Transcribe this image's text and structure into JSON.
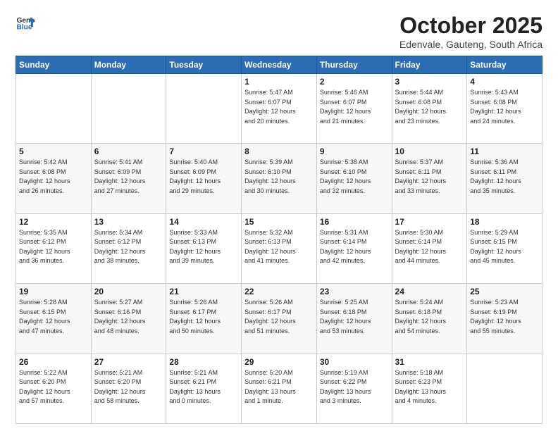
{
  "header": {
    "logo_general": "General",
    "logo_blue": "Blue",
    "title": "October 2025",
    "subtitle": "Edenvale, Gauteng, South Africa"
  },
  "weekdays": [
    "Sunday",
    "Monday",
    "Tuesday",
    "Wednesday",
    "Thursday",
    "Friday",
    "Saturday"
  ],
  "weeks": [
    [
      {
        "day": "",
        "info": ""
      },
      {
        "day": "",
        "info": ""
      },
      {
        "day": "",
        "info": ""
      },
      {
        "day": "1",
        "info": "Sunrise: 5:47 AM\nSunset: 6:07 PM\nDaylight: 12 hours\nand 20 minutes."
      },
      {
        "day": "2",
        "info": "Sunrise: 5:46 AM\nSunset: 6:07 PM\nDaylight: 12 hours\nand 21 minutes."
      },
      {
        "day": "3",
        "info": "Sunrise: 5:44 AM\nSunset: 6:08 PM\nDaylight: 12 hours\nand 23 minutes."
      },
      {
        "day": "4",
        "info": "Sunrise: 5:43 AM\nSunset: 6:08 PM\nDaylight: 12 hours\nand 24 minutes."
      }
    ],
    [
      {
        "day": "5",
        "info": "Sunrise: 5:42 AM\nSunset: 6:08 PM\nDaylight: 12 hours\nand 26 minutes."
      },
      {
        "day": "6",
        "info": "Sunrise: 5:41 AM\nSunset: 6:09 PM\nDaylight: 12 hours\nand 27 minutes."
      },
      {
        "day": "7",
        "info": "Sunrise: 5:40 AM\nSunset: 6:09 PM\nDaylight: 12 hours\nand 29 minutes."
      },
      {
        "day": "8",
        "info": "Sunrise: 5:39 AM\nSunset: 6:10 PM\nDaylight: 12 hours\nand 30 minutes."
      },
      {
        "day": "9",
        "info": "Sunrise: 5:38 AM\nSunset: 6:10 PM\nDaylight: 12 hours\nand 32 minutes."
      },
      {
        "day": "10",
        "info": "Sunrise: 5:37 AM\nSunset: 6:11 PM\nDaylight: 12 hours\nand 33 minutes."
      },
      {
        "day": "11",
        "info": "Sunrise: 5:36 AM\nSunset: 6:11 PM\nDaylight: 12 hours\nand 35 minutes."
      }
    ],
    [
      {
        "day": "12",
        "info": "Sunrise: 5:35 AM\nSunset: 6:12 PM\nDaylight: 12 hours\nand 36 minutes."
      },
      {
        "day": "13",
        "info": "Sunrise: 5:34 AM\nSunset: 6:12 PM\nDaylight: 12 hours\nand 38 minutes."
      },
      {
        "day": "14",
        "info": "Sunrise: 5:33 AM\nSunset: 6:13 PM\nDaylight: 12 hours\nand 39 minutes."
      },
      {
        "day": "15",
        "info": "Sunrise: 5:32 AM\nSunset: 6:13 PM\nDaylight: 12 hours\nand 41 minutes."
      },
      {
        "day": "16",
        "info": "Sunrise: 5:31 AM\nSunset: 6:14 PM\nDaylight: 12 hours\nand 42 minutes."
      },
      {
        "day": "17",
        "info": "Sunrise: 5:30 AM\nSunset: 6:14 PM\nDaylight: 12 hours\nand 44 minutes."
      },
      {
        "day": "18",
        "info": "Sunrise: 5:29 AM\nSunset: 6:15 PM\nDaylight: 12 hours\nand 45 minutes."
      }
    ],
    [
      {
        "day": "19",
        "info": "Sunrise: 5:28 AM\nSunset: 6:15 PM\nDaylight: 12 hours\nand 47 minutes."
      },
      {
        "day": "20",
        "info": "Sunrise: 5:27 AM\nSunset: 6:16 PM\nDaylight: 12 hours\nand 48 minutes."
      },
      {
        "day": "21",
        "info": "Sunrise: 5:26 AM\nSunset: 6:17 PM\nDaylight: 12 hours\nand 50 minutes."
      },
      {
        "day": "22",
        "info": "Sunrise: 5:26 AM\nSunset: 6:17 PM\nDaylight: 12 hours\nand 51 minutes."
      },
      {
        "day": "23",
        "info": "Sunrise: 5:25 AM\nSunset: 6:18 PM\nDaylight: 12 hours\nand 53 minutes."
      },
      {
        "day": "24",
        "info": "Sunrise: 5:24 AM\nSunset: 6:18 PM\nDaylight: 12 hours\nand 54 minutes."
      },
      {
        "day": "25",
        "info": "Sunrise: 5:23 AM\nSunset: 6:19 PM\nDaylight: 12 hours\nand 55 minutes."
      }
    ],
    [
      {
        "day": "26",
        "info": "Sunrise: 5:22 AM\nSunset: 6:20 PM\nDaylight: 12 hours\nand 57 minutes."
      },
      {
        "day": "27",
        "info": "Sunrise: 5:21 AM\nSunset: 6:20 PM\nDaylight: 12 hours\nand 58 minutes."
      },
      {
        "day": "28",
        "info": "Sunrise: 5:21 AM\nSunset: 6:21 PM\nDaylight: 13 hours\nand 0 minutes."
      },
      {
        "day": "29",
        "info": "Sunrise: 5:20 AM\nSunset: 6:21 PM\nDaylight: 13 hours\nand 1 minute."
      },
      {
        "day": "30",
        "info": "Sunrise: 5:19 AM\nSunset: 6:22 PM\nDaylight: 13 hours\nand 3 minutes."
      },
      {
        "day": "31",
        "info": "Sunrise: 5:18 AM\nSunset: 6:23 PM\nDaylight: 13 hours\nand 4 minutes."
      },
      {
        "day": "",
        "info": ""
      }
    ]
  ]
}
